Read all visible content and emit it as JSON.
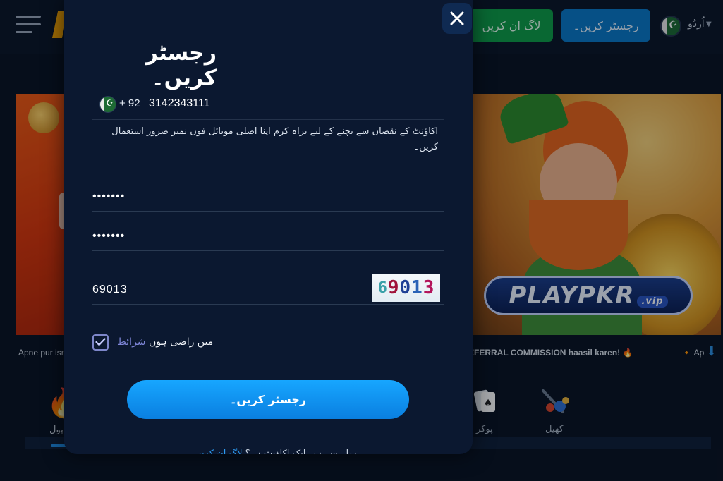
{
  "header": {
    "login_label": "لاگ ان کریں",
    "register_label": "رجسٹر کریں۔",
    "language_label": "اُردُو"
  },
  "background": {
    "ticker_left": "Apne pur isr",
    "ticker_right": "EFERRAL COMMISSION haasil karen! 🔥",
    "ticker_right2": "🔸 Ap",
    "banner_logo_text": "PLAYPKR",
    "banner_logo_suffix": ".vip",
    "categories": [
      {
        "label": "پول",
        "icon": "fire-icon",
        "active": true
      },
      {
        "label": "پوکر",
        "icon": "playing-cards-icon",
        "active": false
      },
      {
        "label": "کھیل",
        "icon": "sports-icon",
        "active": false
      }
    ]
  },
  "modal": {
    "title": "رجسٹر کریں۔",
    "phone": {
      "country_code": "+ 92",
      "value": "3142343111",
      "flag_icon": "pakistan-flag-icon"
    },
    "phone_hint": "اکاؤنٹ کے نقصان سے بچنے کے لیے براہ کرم اپنا اصلی موبائل فون نمبر ضرور استعمال کریں۔",
    "password": {
      "value": "•••••••"
    },
    "confirm_password": {
      "value": "•••••••"
    },
    "captcha": {
      "value": "69013",
      "image_digits": [
        "6",
        "9",
        "0",
        "1",
        "3"
      ]
    },
    "agree": {
      "checked": true,
      "text": "میں راضی ہوں",
      "link_text": "شرائط"
    },
    "submit_label": "رجسٹر کریں۔",
    "bottom_text": "پہلے سے ہی ایک اکاؤنٹ ہے؟",
    "bottom_link": "لاگ ان کریں"
  },
  "colors": {
    "modal_bg": "#0b1830",
    "accent": "#0a7fe0",
    "login_green": "#0e9d48",
    "link": "#7e86d8"
  }
}
